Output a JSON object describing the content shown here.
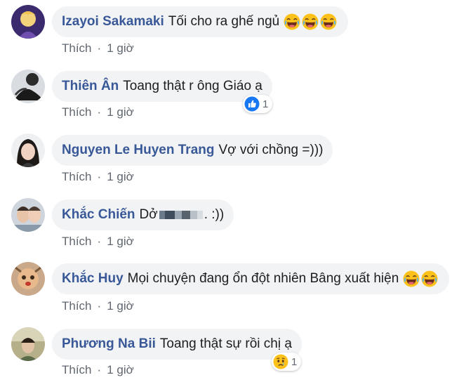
{
  "comments": [
    {
      "name": "Izayoi Sakamaki",
      "text": "Tối cho ra ghế ngủ",
      "emojis": [
        "laugh-cry-emoji",
        "laugh-cry-emoji",
        "laugh-cry-emoji"
      ],
      "like_label": "Thích",
      "separator": "·",
      "time": "1 giờ"
    },
    {
      "name": "Thiên Ân",
      "text": "Toang thật r ông Giáo ạ",
      "like_label": "Thích",
      "separator": "·",
      "time": "1 giờ",
      "reaction": {
        "icon": "like-reaction-icon",
        "count": "1"
      }
    },
    {
      "name": "Nguyen Le Huyen Trang",
      "text": "Vợ với chồng =)))",
      "like_label": "Thích",
      "separator": "·",
      "time": "1 giờ"
    },
    {
      "name": "Khắc Chiến",
      "text_before": "Dở",
      "text_after": ". :))",
      "like_label": "Thích",
      "separator": "·",
      "time": "1 giờ"
    },
    {
      "name": "Khắc Huy",
      "text": "Mọi chuyện đang ổn đột nhiên Bâng xuất hiện",
      "emojis": [
        "laugh-cry-emoji",
        "laugh-cry-emoji"
      ],
      "like_label": "Thích",
      "separator": "·",
      "time": "1 giờ"
    },
    {
      "name": "Phương Na Bii",
      "text": "Toang thật sự rồi chị ạ",
      "like_label": "Thích",
      "separator": "·",
      "time": "1 giờ",
      "reaction": {
        "icon": "sad-reaction-icon",
        "count": "1"
      }
    }
  ],
  "colors": {
    "name": "#385898",
    "bubble": "#f2f3f5",
    "meta": "#606770",
    "like_blue": "#1877f2",
    "emoji_yellow": "#fcc21b"
  }
}
